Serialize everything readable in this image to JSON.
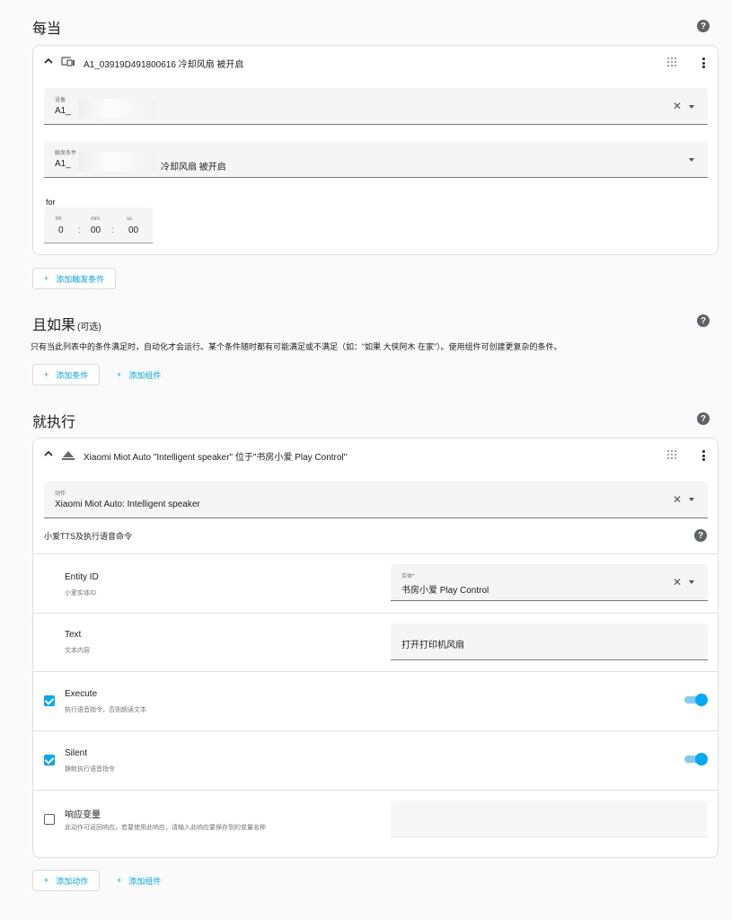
{
  "triggers": {
    "heading": "每当",
    "card": {
      "title": "A1_03919D491800616 冷却风扇 被开启",
      "device_label": "设备",
      "device_value": "A1_",
      "trigger_label": "触发条件",
      "trigger_value_prefix": "A1_",
      "trigger_value_suffix": "冷却风扇 被开启",
      "for_label": "for",
      "duration": {
        "hh_label": "hh",
        "mm_label": "mm",
        "ss_label": "ss",
        "hh": "0",
        "mm": "00",
        "ss": "00",
        "sep": ":"
      }
    },
    "add_trigger": "添加触发条件"
  },
  "conditions": {
    "heading": "且如果",
    "optional": "(可选)",
    "description": "只有当此列表中的条件满足时，自动化才会运行。某个条件随时都有可能满足或不满足（如：“如果 大侠阿木 在家”）。使用组件可创建更复杂的条件。",
    "add_condition": "添加条件",
    "add_block": "添加组件"
  },
  "actions": {
    "heading": "就执行",
    "card": {
      "title": "Xiaomi Miot Auto \"Intelligent speaker\" 位于\"书房小爱 Play Control\"",
      "action_label": "动作",
      "action_value": "Xiaomi Miot Auto: Intelligent speaker",
      "service_description": "小爱TTS及执行语音命令",
      "entity_name": "Entity ID",
      "entity_desc": "小爱实体ID",
      "entity_field_label": "实体*",
      "entity_field_value": "书房小爱 Play Control",
      "text_name": "Text",
      "text_desc": "文本内容",
      "text_value": "打开打印机风扇",
      "execute_name": "Execute",
      "execute_desc": "执行语音指令，否则朗读文本",
      "silent_name": "Silent",
      "silent_desc": "静默执行语音指令",
      "response_name": "响应变量",
      "response_desc": "此动作可返回响应。若要使用此响应，请输入此响应要保存到的变量名称"
    },
    "add_action": "添加动作",
    "add_block": "添加组件"
  },
  "icons": {
    "help": "?",
    "plus": "+",
    "clear": "✕"
  },
  "colors": {
    "accent": "#03a9f4"
  }
}
